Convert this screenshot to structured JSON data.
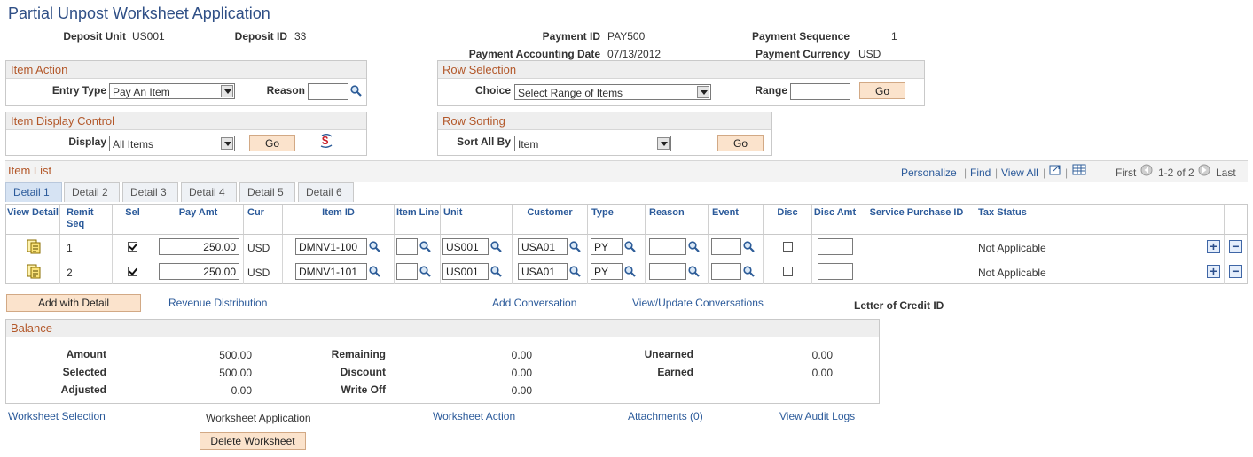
{
  "page": {
    "title": "Partial Unpost Worksheet Application"
  },
  "header": {
    "deposit_unit_label": "Deposit Unit",
    "deposit_unit": "US001",
    "deposit_id_label": "Deposit ID",
    "deposit_id": "33",
    "payment_id_label": "Payment ID",
    "payment_id": "PAY500",
    "payment_sequence_label": "Payment Sequence",
    "payment_sequence": "1",
    "payment_accounting_date_label": "Payment Accounting Date",
    "payment_accounting_date": "07/13/2012",
    "payment_currency_label": "Payment Currency",
    "payment_currency": "USD"
  },
  "item_action": {
    "title": "Item Action",
    "entry_type_label": "Entry Type",
    "entry_type": "Pay An Item",
    "reason_label": "Reason",
    "reason": ""
  },
  "row_selection": {
    "title": "Row Selection",
    "choice_label": "Choice",
    "choice": "Select Range of Items",
    "range_label": "Range",
    "range": "",
    "go_label": "Go"
  },
  "item_display": {
    "title": "Item Display Control",
    "display_label": "Display",
    "display": "All Items",
    "go_label": "Go"
  },
  "row_sorting": {
    "title": "Row Sorting",
    "sort_label": "Sort All By",
    "sort_value": "Item",
    "go_label": "Go"
  },
  "item_list": {
    "title": "Item List",
    "nav": {
      "personalize": "Personalize",
      "find": "Find",
      "view_all": "View All",
      "first": "First",
      "range": "1-2 of 2",
      "last": "Last"
    },
    "tabs": [
      "Detail 1",
      "Detail 2",
      "Detail 3",
      "Detail 4",
      "Detail 5",
      "Detail 6"
    ],
    "columns": [
      "View Detail",
      "Remit Seq",
      "Sel",
      "Pay Amt",
      "Cur",
      "Item ID",
      "Item Line",
      "Unit",
      "Customer",
      "Type",
      "Reason",
      "Event",
      "Disc",
      "Disc Amt",
      "Service Purchase ID",
      "Tax Status"
    ],
    "rows": [
      {
        "seq": "1",
        "sel": true,
        "pay_amt": "250.00",
        "cur": "USD",
        "item_id": "DMNV1-100",
        "item_line": "",
        "unit": "US001",
        "customer": "USA01",
        "type": "PY",
        "reason": "",
        "event": "",
        "disc": false,
        "disc_amt": "",
        "service_purchase_id": "",
        "tax_status": "Not Applicable"
      },
      {
        "seq": "2",
        "sel": true,
        "pay_amt": "250.00",
        "cur": "USD",
        "item_id": "DMNV1-101",
        "item_line": "",
        "unit": "US001",
        "customer": "USA01",
        "type": "PY",
        "reason": "",
        "event": "",
        "disc": false,
        "disc_amt": "",
        "service_purchase_id": "",
        "tax_status": "Not Applicable"
      }
    ]
  },
  "actions": {
    "add_with_detail": "Add with Detail",
    "revenue_distribution": "Revenue Distribution",
    "add_conversation": "Add Conversation",
    "view_update_conversations": "View/Update Conversations",
    "letter_of_credit_label": "Letter of Credit ID"
  },
  "balance": {
    "title": "Balance",
    "amount_label": "Amount",
    "amount": "500.00",
    "selected_label": "Selected",
    "selected": "500.00",
    "adjusted_label": "Adjusted",
    "adjusted": "0.00",
    "remaining_label": "Remaining",
    "remaining": "0.00",
    "discount_label": "Discount",
    "discount": "0.00",
    "write_off_label": "Write Off",
    "write_off": "0.00",
    "unearned_label": "Unearned",
    "unearned": "0.00",
    "earned_label": "Earned",
    "earned": "0.00"
  },
  "footer": {
    "worksheet_selection": "Worksheet Selection",
    "worksheet_application": "Worksheet Application",
    "worksheet_action": "Worksheet Action",
    "attachments": "Attachments (0)",
    "view_audit_logs": "View Audit Logs",
    "delete_worksheet": "Delete Worksheet"
  },
  "colors": {
    "title": "#2f4f86",
    "section_header": "#b3582a",
    "link": "#2b5a9a",
    "button_bg": "#fbe3cc"
  }
}
